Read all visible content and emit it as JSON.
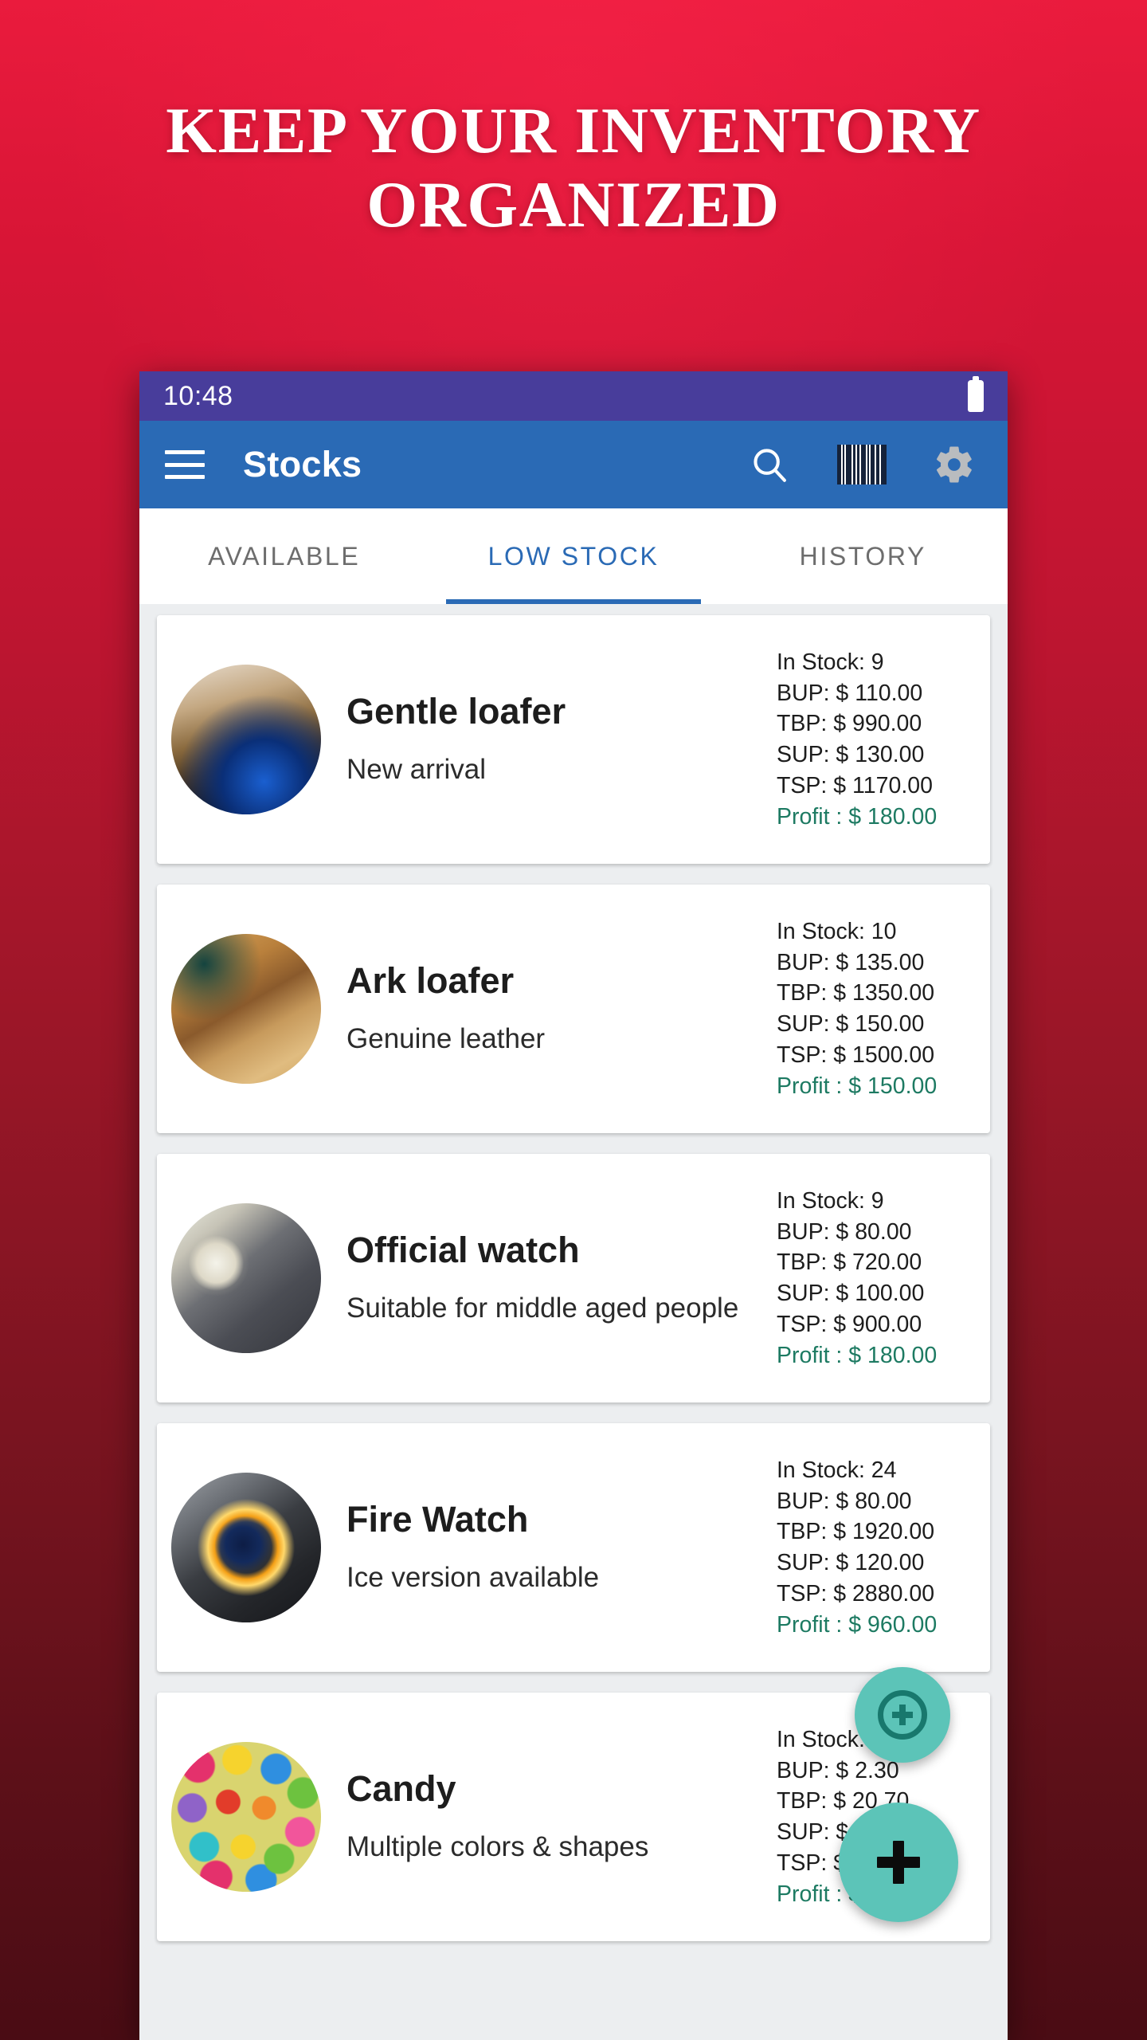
{
  "promo": {
    "headline_line1": "KEEP YOUR INVENTORY",
    "headline_line2": "ORGANIZED",
    "background_top_color": "#ea1b3d",
    "background_bottom_color": "#4a0c14"
  },
  "statusbar": {
    "time": "10:48",
    "background_color": "#483d9b",
    "battery_icon": "battery-icon"
  },
  "appbar": {
    "title": "Stocks",
    "background_color": "#2a6ab5",
    "menu_icon": "hamburger-menu-icon",
    "search_icon": "search-icon",
    "barcode_icon": "barcode-scan-icon",
    "settings_icon": "gear-icon"
  },
  "tabs": {
    "items": [
      {
        "label": "AVAILABLE",
        "active": false
      },
      {
        "label": "LOW STOCK",
        "active": true
      },
      {
        "label": "HISTORY",
        "active": false
      }
    ],
    "active_color": "#2a6ab5",
    "inactive_color": "#6d6d6d"
  },
  "stock_list": {
    "profit_color": "#1d7a62",
    "items": [
      {
        "name": "Gentle loafer",
        "description": "New arrival",
        "in_stock": "In Stock: 9",
        "bup": "BUP: $ 110.00",
        "tbp": "TBP: $ 990.00",
        "sup": "SUP: $ 130.00",
        "tsp": "TSP: $ 1170.00",
        "profit": "Profit : $ 180.00"
      },
      {
        "name": "Ark loafer",
        "description": "Genuine leather",
        "in_stock": "In Stock: 10",
        "bup": "BUP: $ 135.00",
        "tbp": "TBP: $ 1350.00",
        "sup": "SUP: $ 150.00",
        "tsp": "TSP: $ 1500.00",
        "profit": "Profit : $ 150.00"
      },
      {
        "name": "Official watch",
        "description": "Suitable for middle aged people",
        "in_stock": "In Stock: 9",
        "bup": "BUP: $ 80.00",
        "tbp": "TBP: $ 720.00",
        "sup": "SUP: $ 100.00",
        "tsp": "TSP: $ 900.00",
        "profit": "Profit : $ 180.00"
      },
      {
        "name": "Fire Watch",
        "description": "Ice version available",
        "in_stock": "In Stock: 24",
        "bup": "BUP: $ 80.00",
        "tbp": "TBP: $ 1920.00",
        "sup": "SUP: $ 120.00",
        "tsp": "TSP: $ 2880.00",
        "profit": "Profit : $ 960.00"
      },
      {
        "name": "Candy",
        "description": "Multiple colors & shapes",
        "in_stock": "In Stock: 9",
        "bup": "BUP: $ 2.30",
        "tbp": "TBP: $ 20.70",
        "sup": "SUP: $ 2.50",
        "tsp": "TSP: $ 22.50",
        "profit": "Profit : $ 1.80"
      }
    ]
  },
  "fabs": {
    "mini_icon": "circle-plus-icon",
    "main_icon": "plus-icon",
    "color": "#5cc4b8"
  }
}
